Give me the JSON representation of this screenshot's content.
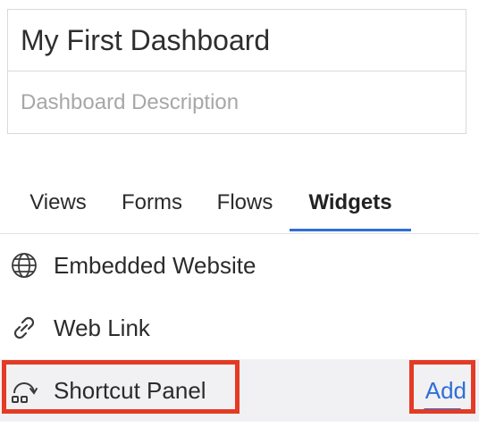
{
  "dashboard": {
    "title": "My First Dashboard",
    "description_placeholder": "Dashboard Description"
  },
  "tabs": [
    {
      "label": "Views",
      "active": false
    },
    {
      "label": "Forms",
      "active": false
    },
    {
      "label": "Flows",
      "active": false
    },
    {
      "label": "Widgets",
      "active": true
    }
  ],
  "widgets": [
    {
      "label": "Embedded Website",
      "icon": "globe-icon"
    },
    {
      "label": "Web Link",
      "icon": "link-icon"
    },
    {
      "label": "Shortcut Panel",
      "icon": "shortcut-panel-icon",
      "action": "Add"
    }
  ],
  "colors": {
    "accent": "#2f6fd6",
    "highlight": "#e33b25",
    "selected_row": "#f1f1f4"
  }
}
